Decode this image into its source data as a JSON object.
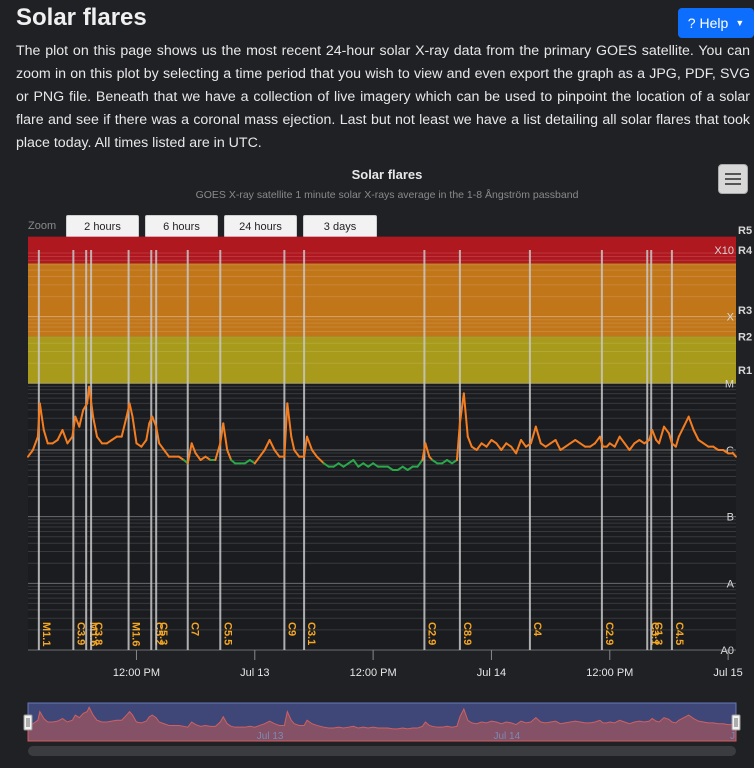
{
  "page": {
    "title": "Solar flares",
    "help_label": "Help",
    "intro": "The plot on this page shows us the most recent 24-hour solar X-ray data from the primary GOES satellite. You can zoom in on this plot by selecting a time period that you wish to view and even export the graph as a JPG, PDF, SVG or PNG file. Beneath that we have a collection of live imagery which can be used to pinpoint the location of a solar flare and see if there was a coronal mass ejection. Last but not least we have a list detailing all solar flares that took place today. All times listed are in UTC."
  },
  "zoom": {
    "label": "Zoom",
    "buttons": [
      "2 hours",
      "6 hours",
      "24 hours",
      "3 days"
    ]
  },
  "colors": {
    "background": "#1f2125",
    "plot_bg": "#1a1c20",
    "flux_line": "#f47d20",
    "flux_line_low": "#2aa84a",
    "flare_line": "#c8c8c8",
    "flare_label": "#f5a623",
    "r_band_red": "#b01820",
    "r_band_orange": "#c17619",
    "r_band_yellow": "#a89a1a",
    "navigator_fill": "#3f4778"
  },
  "chart_data": {
    "type": "line",
    "title": "Solar flares",
    "subtitle": "GOES X-ray satellite 1 minute solar X-rays average in the 1-8 Ångström passband",
    "x_tick_labels": [
      "12:00 PM",
      "Jul 13",
      "12:00 PM",
      "Jul 14",
      "12:00 PM",
      "Jul 15"
    ],
    "x_ticks_hours": [
      12,
      24,
      36,
      48,
      60,
      72
    ],
    "x_range_hours": [
      1,
      72.8
    ],
    "y_scale": "log",
    "y_range_exponent": [
      -9,
      -3
    ],
    "class_labels": [
      {
        "label": "X10",
        "exponent": -3
      },
      {
        "label": "X",
        "exponent": -4
      },
      {
        "label": "M",
        "exponent": -5
      },
      {
        "label": "C",
        "exponent": -6
      },
      {
        "label": "B",
        "exponent": -7
      },
      {
        "label": "A",
        "exponent": -8
      },
      {
        "label": "A0",
        "exponent": -9
      }
    ],
    "radio_blackout_labels": [
      {
        "label": "R5",
        "exponent": -2.7
      },
      {
        "label": "R4",
        "exponent": -3
      },
      {
        "label": "R3",
        "exponent": -3.9
      },
      {
        "label": "R2",
        "exponent": -4.3
      },
      {
        "label": "R1",
        "exponent": -4.8
      }
    ],
    "flares": [
      {
        "class": "M1.1",
        "time_hours": 2.1
      },
      {
        "class": "C3.9",
        "time_hours": 5.6
      },
      {
        "class": "M1.6",
        "time_hours": 6.9
      },
      {
        "class": "C3.8",
        "time_hours": 7.4
      },
      {
        "class": "M1.6",
        "time_hours": 11.2
      },
      {
        "class": "C5.2",
        "time_hours": 13.5
      },
      {
        "class": "C5.3",
        "time_hours": 14.0
      },
      {
        "class": "C7",
        "time_hours": 17.2
      },
      {
        "class": "C5.5",
        "time_hours": 20.5
      },
      {
        "class": "C9",
        "time_hours": 27.0
      },
      {
        "class": "C3.1",
        "time_hours": 29.0
      },
      {
        "class": "C2.9",
        "time_hours": 41.2
      },
      {
        "class": "C8.9",
        "time_hours": 44.8
      },
      {
        "class": "C4",
        "time_hours": 51.9
      },
      {
        "class": "C2.9",
        "time_hours": 59.2
      },
      {
        "class": "C3.1",
        "time_hours": 63.8
      },
      {
        "class": "C1.3",
        "time_hours": 64.2
      },
      {
        "class": "C4.5",
        "time_hours": 66.3
      }
    ],
    "series": [
      {
        "x_hours": [
          1,
          1.5,
          2,
          2.2,
          2.6,
          3,
          3.5,
          4,
          4.5,
          5,
          5.5,
          5.8,
          6.2,
          6.6,
          7,
          7.2,
          7.6,
          8,
          8.5,
          9,
          9.5,
          10,
          10.5,
          11,
          11.3,
          11.6,
          12,
          12.5,
          13,
          13.3,
          13.6,
          14,
          14.3,
          14.8,
          15.3,
          15.8,
          16.3,
          16.8,
          17.2,
          17.6,
          18,
          18.5,
          19,
          19.5,
          20,
          20.5,
          20.8,
          21.2,
          21.6,
          22,
          22.5,
          23,
          23.5,
          24,
          24.5,
          25,
          25.5,
          26,
          26.5,
          27,
          27.3,
          27.7,
          28,
          28.5,
          29,
          29.3,
          29.8,
          30.3,
          31,
          31.5,
          32,
          32.5,
          33,
          33.5,
          34,
          34.5,
          35,
          35.5,
          36,
          36.5,
          37,
          37.5,
          38,
          38.5,
          39,
          39.5,
          40,
          40.5,
          41,
          41.3,
          41.7,
          42,
          42.5,
          43,
          43.5,
          44,
          44.5,
          44.8,
          45.2,
          45.6,
          46,
          46.5,
          47,
          47.5,
          48,
          48.5,
          49,
          49.5,
          50,
          50.5,
          51,
          51.5,
          52,
          52.5,
          53,
          53.5,
          54,
          54.5,
          55,
          55.5,
          56,
          56.5,
          57,
          57.5,
          58,
          58.5,
          59,
          59.3,
          59.7,
          60,
          60.5,
          61,
          61.5,
          62,
          62.5,
          63,
          63.5,
          64,
          64.3,
          64.7,
          65,
          65.5,
          66,
          66.3,
          66.7,
          67,
          67.5,
          68,
          68.5,
          69,
          69.5,
          70,
          70.5,
          71,
          71.5,
          72,
          72.5,
          72.8
        ],
        "log_flux": [
          -6.1,
          -6.0,
          -5.8,
          -5.3,
          -5.7,
          -5.9,
          -5.9,
          -5.85,
          -5.7,
          -5.9,
          -5.8,
          -5.5,
          -5.65,
          -5.4,
          -5.3,
          -5.05,
          -5.5,
          -5.8,
          -5.9,
          -5.9,
          -5.85,
          -5.8,
          -5.8,
          -5.5,
          -5.3,
          -5.5,
          -5.9,
          -5.95,
          -5.85,
          -5.6,
          -5.5,
          -5.65,
          -5.9,
          -6.0,
          -6.1,
          -6.1,
          -6.1,
          -6.15,
          -6.2,
          -5.9,
          -6.05,
          -6.15,
          -6.1,
          -6.15,
          -6.15,
          -5.9,
          -5.6,
          -6.0,
          -6.15,
          -6.2,
          -6.2,
          -6.2,
          -6.15,
          -6.2,
          -6.1,
          -6.0,
          -5.85,
          -6.0,
          -6.1,
          -6.1,
          -5.3,
          -5.8,
          -6.0,
          -6.1,
          -6.1,
          -5.8,
          -6.0,
          -6.1,
          -6.2,
          -6.25,
          -6.25,
          -6.2,
          -6.25,
          -6.2,
          -6.15,
          -6.25,
          -6.2,
          -6.25,
          -6.2,
          -6.25,
          -6.25,
          -6.25,
          -6.3,
          -6.3,
          -6.25,
          -6.3,
          -6.25,
          -6.25,
          -6.15,
          -5.9,
          -6.1,
          -6.15,
          -6.2,
          -6.2,
          -6.15,
          -6.2,
          -6.15,
          -5.6,
          -5.15,
          -5.8,
          -5.95,
          -6.0,
          -5.9,
          -5.95,
          -5.85,
          -5.9,
          -6.0,
          -5.9,
          -5.95,
          -6.05,
          -5.85,
          -5.95,
          -5.9,
          -5.65,
          -5.9,
          -5.95,
          -5.9,
          -5.85,
          -6.0,
          -5.95,
          -5.9,
          -5.85,
          -5.9,
          -5.95,
          -5.95,
          -5.9,
          -5.8,
          -5.95,
          -5.95,
          -5.9,
          -5.95,
          -5.8,
          -5.9,
          -6.0,
          -5.9,
          -5.85,
          -5.9,
          -5.85,
          -5.7,
          -5.85,
          -5.9,
          -5.65,
          -5.75,
          -5.9,
          -5.95,
          -5.8,
          -5.65,
          -5.5,
          -5.7,
          -5.85,
          -5.9,
          -5.95,
          -5.95,
          -6.0,
          -6.0,
          -6.05,
          -6.05,
          -6.1,
          -6.1,
          -6.1
        ]
      }
    ],
    "navigator_labels": [
      {
        "label": "Jul 13",
        "time_hours": 24
      },
      {
        "label": "Jul 14",
        "time_hours": 48
      },
      {
        "label": "J",
        "time_hours": 72
      }
    ]
  }
}
